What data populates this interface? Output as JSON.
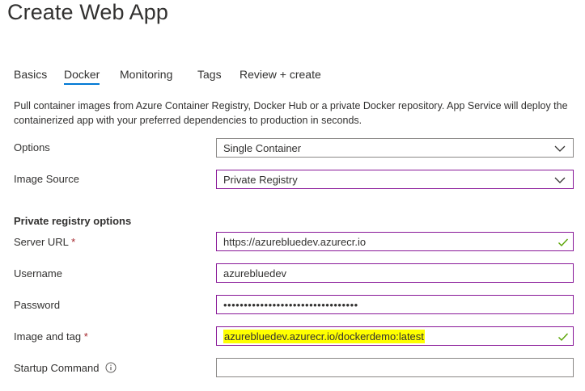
{
  "page": {
    "title": "Create Web App"
  },
  "tabs": [
    {
      "label": "Basics"
    },
    {
      "label": "Docker"
    },
    {
      "label": "Monitoring"
    },
    {
      "label": "Tags"
    },
    {
      "label": "Review + create"
    }
  ],
  "active_tab": "Docker",
  "description": "Pull container images from Azure Container Registry, Docker Hub or a private Docker repository. App Service will deploy the containerized app with your preferred dependencies to production in seconds.",
  "options": {
    "label": "Options",
    "value": "Single Container"
  },
  "image_source": {
    "label": "Image Source",
    "value": "Private Registry"
  },
  "section": {
    "heading": "Private registry options"
  },
  "server_url": {
    "label": "Server URL",
    "required_mark": "*",
    "value": "https://azurebluedev.azurecr.io"
  },
  "username": {
    "label": "Username",
    "value": "azurebluedev"
  },
  "password": {
    "label": "Password",
    "value": "•••••••••••••••••••••••••••••••••"
  },
  "image_tag": {
    "label": "Image and tag",
    "required_mark": "*",
    "value": "azurebluedev.azurecr.io/dockerdemo:latest"
  },
  "startup_command": {
    "label": "Startup Command",
    "value": ""
  },
  "colors": {
    "accent": "#0078d4",
    "field_border_focus": "#881798",
    "check": "#57a300",
    "required": "#a4262c",
    "highlight": "#ffff00"
  },
  "icons": {
    "dropdown": "chevron-down-icon",
    "valid": "checkmark-icon",
    "info": "info-icon"
  }
}
